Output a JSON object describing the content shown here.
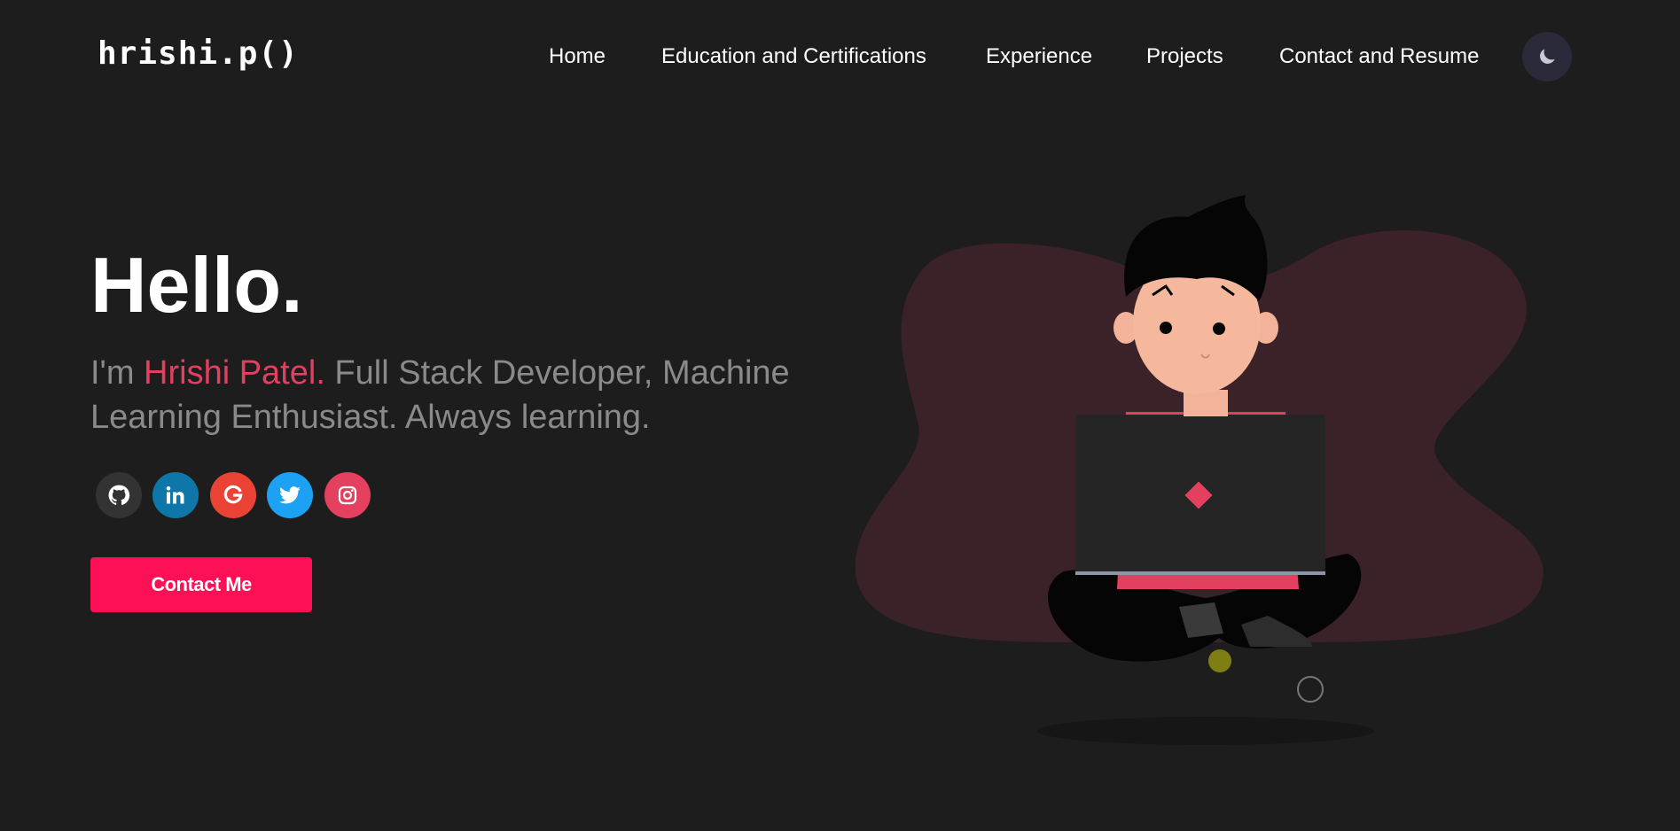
{
  "header": {
    "logo": "hrishi.p()",
    "nav": [
      "Home",
      "Education and Certifications",
      "Experience",
      "Projects",
      "Contact and Resume"
    ],
    "mode_icon": "moon-icon"
  },
  "hero": {
    "title": "Hello.",
    "intro_prefix": "I'm ",
    "name": "Hrishi Patel.",
    "intro_rest": " Full Stack Developer, Machine Learning Enthusiast. Always learning.",
    "contact_button": "Contact Me"
  },
  "socials": [
    {
      "icon": "github-icon",
      "color": "#333333"
    },
    {
      "icon": "linkedin-icon",
      "color": "#0e76a8"
    },
    {
      "icon": "google-icon",
      "color": "#ea4335"
    },
    {
      "icon": "twitter-icon",
      "color": "#1da1f2"
    },
    {
      "icon": "instagram-icon",
      "color": "#e4405f"
    }
  ],
  "colors": {
    "background": "#1d1d1d",
    "accent": "#e3405f",
    "button": "#fe1056",
    "blob": "#3b2228"
  }
}
